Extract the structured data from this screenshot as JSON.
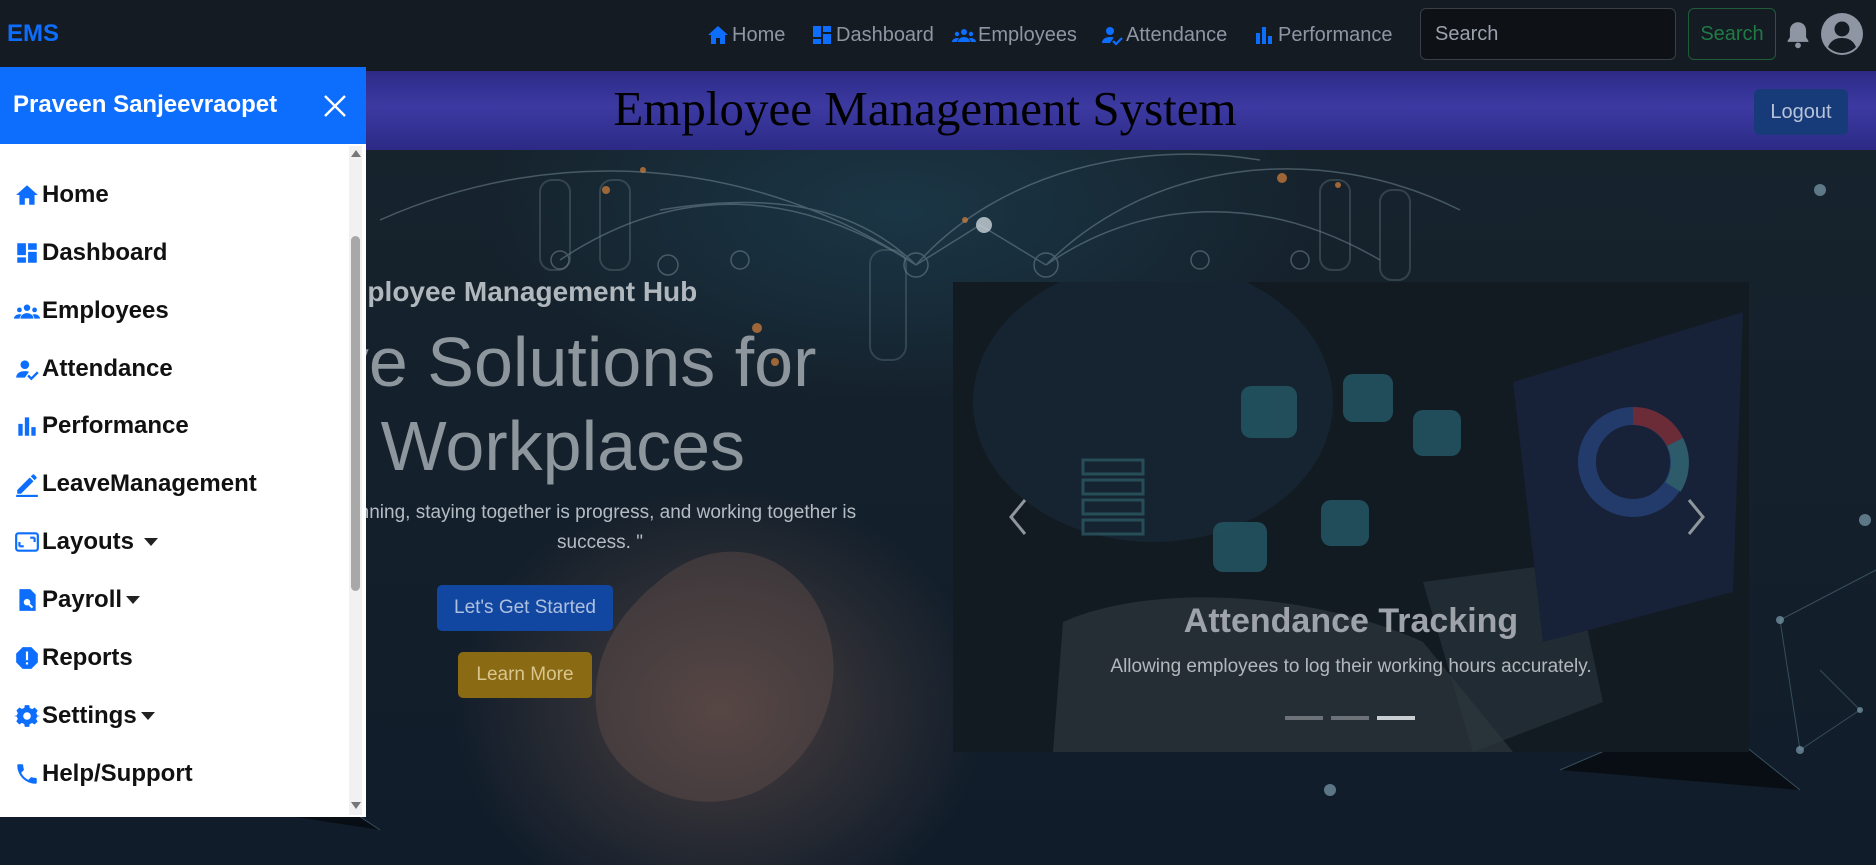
{
  "navbar": {
    "brand": "EMS",
    "links": [
      {
        "label": "Home",
        "icon": "home-icon"
      },
      {
        "label": "Dashboard",
        "icon": "dashboard-icon"
      },
      {
        "label": "Employees",
        "icon": "employees-icon"
      },
      {
        "label": "Attendance",
        "icon": "attendance-icon"
      },
      {
        "label": "Performance",
        "icon": "performance-icon"
      }
    ],
    "search": {
      "placeholder": "Search",
      "button_label": "Search"
    },
    "icons": [
      "bell-icon",
      "user-avatar-icon"
    ]
  },
  "header": {
    "title": "Employee Management System",
    "logout_label": "Logout"
  },
  "hero": {
    "subtitle": "o Your Employee Management Hub",
    "title_line1": "ative Solutions for",
    "title_line2": "ern Workplaces",
    "quote_line1": "ginning, staying together is progress, and working together is",
    "quote_line2": "success. \"",
    "primary_button": "Let's Get Started",
    "secondary_button": "Learn More"
  },
  "carousel": {
    "caption_title": "Attendance Tracking",
    "caption_text": "Allowing employees to log their working hours accurately.",
    "slide_count": 3,
    "active_slide": 3
  },
  "sidebar": {
    "user_name": "Praveen Sanjeevraopet",
    "items": [
      {
        "label": "Home",
        "icon": "home-icon",
        "dropdown": false
      },
      {
        "label": "Dashboard",
        "icon": "dashboard-icon",
        "dropdown": false
      },
      {
        "label": "Employees",
        "icon": "employees-icon",
        "dropdown": false
      },
      {
        "label": "Attendance",
        "icon": "attendance-icon",
        "dropdown": false
      },
      {
        "label": "Performance",
        "icon": "performance-icon",
        "dropdown": false
      },
      {
        "label": "LeaveManagement",
        "icon": "edit-icon",
        "dropdown": false
      },
      {
        "label": "Layouts",
        "icon": "layouts-icon",
        "dropdown": true
      },
      {
        "label": "Payroll",
        "icon": "payroll-icon",
        "dropdown": true
      },
      {
        "label": "Reports",
        "icon": "reports-icon",
        "dropdown": false
      },
      {
        "label": "Settings",
        "icon": "gear-icon",
        "dropdown": true
      },
      {
        "label": "Help/Support",
        "icon": "phone-icon",
        "dropdown": false
      }
    ]
  },
  "colors": {
    "primary": "#0d6efd",
    "navbar_bg": "#151b23",
    "header_gradient": "#3c3aa2",
    "sidebar_bg": "#ffffff",
    "success_outline": "#1f7a45",
    "warning": "#ffc107"
  }
}
